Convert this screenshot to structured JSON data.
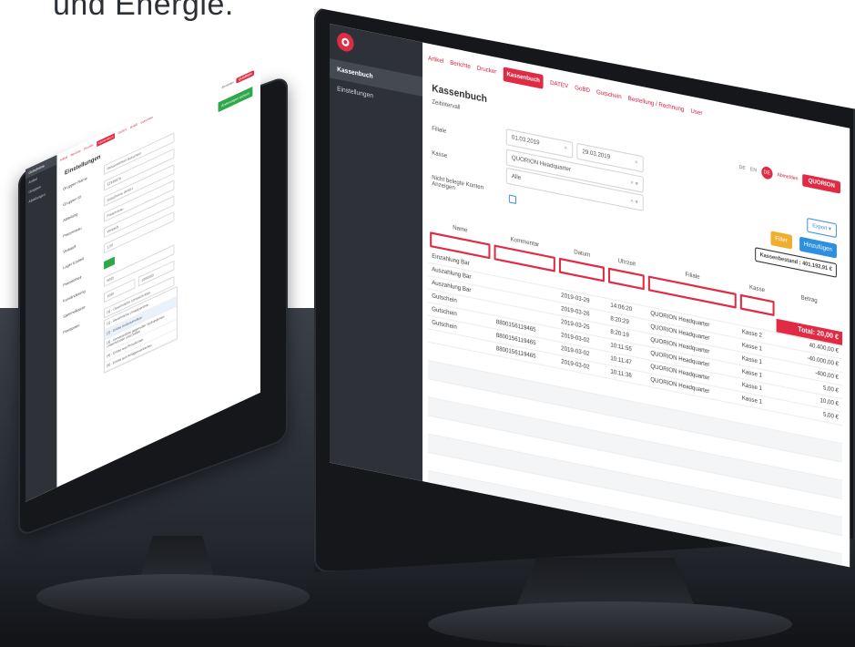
{
  "tagline": "und Energie.",
  "big": {
    "sidebar": {
      "items": [
        "Kassenbuch",
        "Einstellungen"
      ]
    },
    "nav": [
      "Artikel",
      "Berichte",
      "Drucker",
      "Kassenbuch",
      "DATEV",
      "GoBD",
      "Gutschein",
      "Bestellung / Rechnung",
      "User"
    ],
    "topright": {
      "lang1": "DE",
      "lang2": "EN",
      "avatar": "DE",
      "logout": "Abmelden",
      "brand": "QUORION"
    },
    "title": "Kassenbuch",
    "subtitle": "Zeitintervall",
    "filters": {
      "filiale_label": "Filiale",
      "date_from": "01.03.2019",
      "date_to": "29.03.2019",
      "filiale_value": "QUORION Headquarter",
      "kasse_label": "Kasse",
      "kasse_value": "Alle",
      "unbelegt_label_1": "Nicht belegte Konten",
      "unbelegt_label_2": "Anzeigen"
    },
    "buttons": {
      "export": "Export ▾",
      "filter": "Filter",
      "add": "Hinzufügen",
      "balance": "Kassenbestand : 401.192,91 €"
    },
    "table": {
      "headers": [
        "Name",
        "Kommentar",
        "Datum",
        "Uhrzeit",
        "Filiale",
        "Kasse",
        "Betrag"
      ],
      "total": "Total: 20,00 €",
      "rows": [
        [
          "Einzahlung Bar",
          "",
          "",
          "",
          "",
          "",
          ""
        ],
        [
          "Auszahlung Bar",
          "",
          "2019-03-29",
          "14:06:20",
          "QUORION Headquarter",
          "Kasse 2",
          "40.400,00 €"
        ],
        [
          "Auszahlung Bar",
          "",
          "2019-03-26",
          "8:20:29",
          "QUORION Headquarter",
          "Kasse 1",
          "-40.000,00 €"
        ],
        [
          "Gutschein",
          "",
          "2019-03-25",
          "8:20:19",
          "QUORION Headquarter",
          "Kasse 1",
          "-400,00 €"
        ],
        [
          "Gutschein",
          "8800156119465",
          "2019-03-02",
          "10:11:55",
          "QUORION Headquarter",
          "Kasse 1",
          "5,00 €"
        ],
        [
          "Gutschein",
          "8800156119465",
          "2019-03-02",
          "10:11:47",
          "QUORION Headquarter",
          "Kasse 1",
          "10,00 €"
        ],
        [
          "",
          "8800156119465",
          "2019-03-02",
          "10:11:36",
          "QUORION Headquarter",
          "Kasse 1",
          "5,00 €"
        ]
      ]
    }
  },
  "small": {
    "sidebar": [
      "Gutscheine",
      "Artikel",
      "Gruppen",
      "Abteilungen"
    ],
    "nav": [
      "Artikel",
      "Berichte",
      "Drucker",
      "Kassenbuch",
      "DATEV",
      "GoBD",
      "Gutschein",
      "Bestellung / Rechnung",
      "User"
    ],
    "title": "Einstellungen",
    "green_button": "Änderungen sichern",
    "top": {
      "brand": "QUORION",
      "logout": "Abmelden"
    },
    "fields": [
      {
        "label": "Gruppen Name",
        "value": "Gesamtartikel Gutschein"
      },
      {
        "label": "Gruppen ID",
        "value": "12345678"
      },
      {
        "label": "Abteilung",
        "value": "Gutscheine GmbH"
      },
      {
        "label": "Preisniveau",
        "value": "Preisniveau"
      },
      {
        "label": "Verkauft",
        "value": "Verkauft"
      },
      {
        "label": "Lager Einheit",
        "value": "1.00"
      },
      {
        "label": "Preiseinheit",
        "value": ""
      },
      {
        "label": "Kursänderung",
        "value": "6000"
      },
      {
        "label": "Sammelkasse",
        "value": ""
      },
      {
        "label": "Positionen",
        "value": "[1] - Gewinnliche Umsatzerlöse"
      }
    ],
    "range_from": "1000",
    "range_to": "1000000",
    "options": [
      "[1] - Gewinnliche Umsatzerlöse",
      "[2] - Erlöse Außenumsätze",
      "[3] - Umsatzerlöse gegenüber verbundenen Unternehmen und Dritten",
      "[4] - Erlöse aus Provisionen",
      "[5] - Erlöse aus Anlagenverkäufen"
    ]
  }
}
